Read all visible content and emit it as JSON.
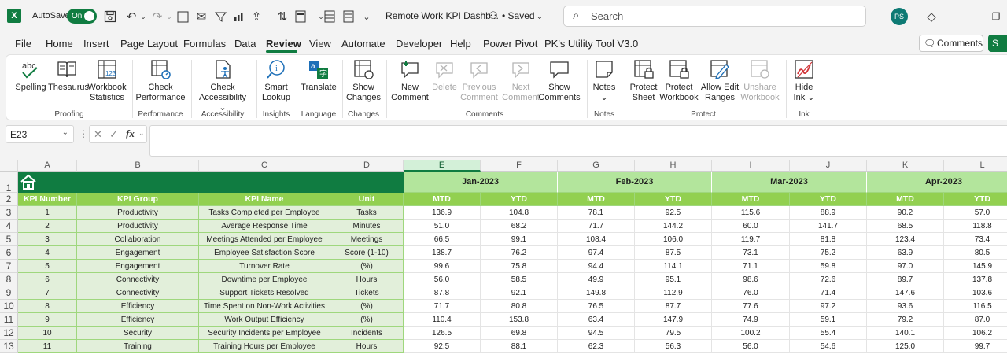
{
  "titlebar": {
    "autosave_label": "AutoSave",
    "autosave_state": "On",
    "doc_title": "Remote Work KPI Dashb...",
    "saved_status": "• Saved",
    "search_placeholder": "Search",
    "avatar_initials": "PS"
  },
  "menu": {
    "items": [
      "File",
      "Home",
      "Insert",
      "Page Layout",
      "Formulas",
      "Data",
      "Review",
      "View",
      "Automate",
      "Developer",
      "Help",
      "Power Pivot",
      "PK's Utility Tool V3.0"
    ],
    "active": "Review",
    "comments_label": "Comments",
    "share_label": "S"
  },
  "ribbon": {
    "spelling": "Spelling",
    "thesaurus": "Thesaurus",
    "workbook_statistics_1": "Workbook",
    "workbook_statistics_2": "Statistics",
    "proofing": "Proofing",
    "check_performance_1": "Check",
    "check_performance_2": "Performance",
    "performance": "Performance",
    "check_accessibility_1": "Check",
    "check_accessibility_2": "Accessibility ⌄",
    "accessibility": "Accessibility",
    "smart_lookup_1": "Smart",
    "smart_lookup_2": "Lookup",
    "insights": "Insights",
    "translate": "Translate",
    "language": "Language",
    "show_changes_1": "Show",
    "show_changes_2": "Changes",
    "changes": "Changes",
    "new_comment_1": "New",
    "new_comment_2": "Comment",
    "delete": "Delete",
    "previous_comment_1": "Previous",
    "previous_comment_2": "Comment",
    "next_comment_1": "Next",
    "next_comment_2": "Comment",
    "show_comments_1": "Show",
    "show_comments_2": "Comments",
    "comments_group": "Comments",
    "notes": "Notes",
    "notes_chevron": "⌄",
    "notes_group": "Notes",
    "protect_sheet_1": "Protect",
    "protect_sheet_2": "Sheet",
    "protect_workbook_1": "Protect",
    "protect_workbook_2": "Workbook",
    "allow_edit_ranges_1": "Allow Edit",
    "allow_edit_ranges_2": "Ranges",
    "unshare_workbook_1": "Unshare",
    "unshare_workbook_2": "Workbook",
    "protect_group": "Protect",
    "hide_ink_1": "Hide",
    "hide_ink_2": "Ink ⌄",
    "ink_group": "Ink"
  },
  "formula_bar": {
    "name_box": "E23",
    "fx": "fx",
    "value": ""
  },
  "sheet": {
    "columns": [
      "A",
      "B",
      "C",
      "D",
      "E",
      "F",
      "G",
      "H",
      "I",
      "J",
      "K",
      "L"
    ],
    "selected_column": "E",
    "rows": [
      "1",
      "2",
      "3",
      "4",
      "5",
      "6",
      "7",
      "8",
      "9",
      "10",
      "11",
      "12",
      "13"
    ],
    "months": [
      "Jan-2023",
      "Feb-2023",
      "Mar-2023",
      "Apr-2023"
    ],
    "headers": [
      "KPI Number",
      "KPI Group",
      "KPI Name",
      "Unit",
      "MTD",
      "YTD",
      "MTD",
      "YTD",
      "MTD",
      "YTD",
      "MTD",
      "YTD"
    ],
    "data": [
      [
        "1",
        "Productivity",
        "Tasks Completed per Employee",
        "Tasks",
        "136.9",
        "104.8",
        "78.1",
        "92.5",
        "115.6",
        "88.9",
        "90.2",
        "57.0"
      ],
      [
        "2",
        "Productivity",
        "Average Response Time",
        "Minutes",
        "51.0",
        "68.2",
        "71.7",
        "144.2",
        "60.0",
        "141.7",
        "68.5",
        "118.8"
      ],
      [
        "3",
        "Collaboration",
        "Meetings Attended per Employee",
        "Meetings",
        "66.5",
        "99.1",
        "108.4",
        "106.0",
        "119.7",
        "81.8",
        "123.4",
        "73.4"
      ],
      [
        "4",
        "Engagement",
        "Employee Satisfaction Score",
        "Score (1-10)",
        "138.7",
        "76.2",
        "97.4",
        "87.5",
        "73.1",
        "75.2",
        "63.9",
        "80.5"
      ],
      [
        "5",
        "Engagement",
        "Turnover Rate",
        "(%)",
        "99.6",
        "75.8",
        "94.4",
        "114.1",
        "71.1",
        "59.8",
        "97.0",
        "145.9"
      ],
      [
        "6",
        "Connectivity",
        "Downtime per Employee",
        "Hours",
        "56.0",
        "58.5",
        "49.9",
        "95.1",
        "98.6",
        "72.6",
        "89.7",
        "137.8"
      ],
      [
        "7",
        "Connectivity",
        "Support Tickets Resolved",
        "Tickets",
        "87.8",
        "92.1",
        "149.8",
        "112.9",
        "76.0",
        "71.4",
        "147.6",
        "103.6"
      ],
      [
        "8",
        "Efficiency",
        "Time Spent on Non-Work Activities",
        "(%)",
        "71.7",
        "80.8",
        "76.5",
        "87.7",
        "77.6",
        "97.2",
        "93.6",
        "116.5"
      ],
      [
        "9",
        "Efficiency",
        "Work Output Efficiency",
        "(%)",
        "110.4",
        "153.8",
        "63.4",
        "147.9",
        "74.9",
        "59.1",
        "79.2",
        "87.0"
      ],
      [
        "10",
        "Security",
        "Security Incidents per Employee",
        "Incidents",
        "126.5",
        "69.8",
        "94.5",
        "79.5",
        "100.2",
        "55.4",
        "140.1",
        "106.2"
      ],
      [
        "11",
        "Training",
        "Training Hours per Employee",
        "Hours",
        "92.5",
        "88.1",
        "62.3",
        "56.3",
        "56.0",
        "54.6",
        "125.0",
        "99.7"
      ]
    ]
  }
}
